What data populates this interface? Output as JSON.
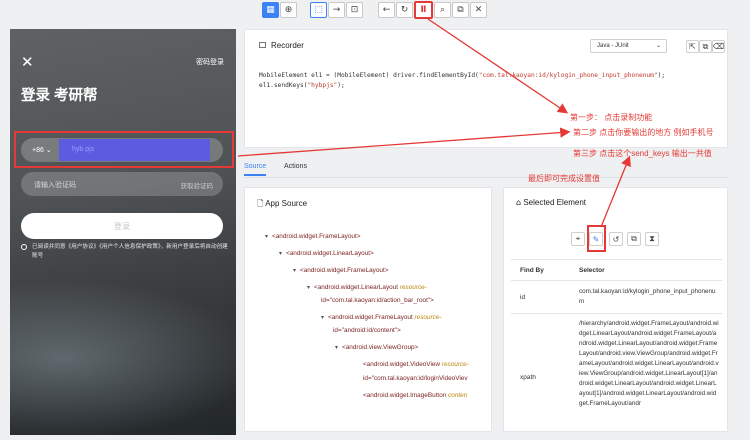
{
  "toolbar": {
    "buttons": [
      {
        "icon": "app-mode-icon",
        "glyph": "▦"
      },
      {
        "icon": "globe-icon",
        "glyph": "⊕"
      },
      {
        "icon": "select-element-icon",
        "glyph": "⬚"
      },
      {
        "icon": "swipe-icon",
        "glyph": "→"
      },
      {
        "icon": "tap-by-coordinates-icon",
        "glyph": "⊡"
      },
      {
        "icon": "back-icon",
        "glyph": "←"
      },
      {
        "icon": "refresh-icon",
        "glyph": "↻"
      },
      {
        "icon": "pause-record-icon",
        "glyph": "Ⅱ"
      },
      {
        "icon": "search-icon",
        "glyph": "⌕"
      },
      {
        "icon": "copy-xml-icon",
        "glyph": "⧉"
      },
      {
        "icon": "quit-icon",
        "glyph": "✕"
      }
    ]
  },
  "phone": {
    "close_glyph": "✕",
    "password_login": "密码登录",
    "title": "登录 考研帮",
    "country_code": "+86",
    "phone_value": "hyb pjs",
    "code_placeholder": "请输入验证码",
    "get_code": "获取验证码",
    "login_button": "登录",
    "agreement": "已阅读并同意《用户协议》《用户个人信息保护政策》，新用户登录后将自动创建账号"
  },
  "recorder": {
    "title": "Recorder",
    "language": "Java - JUnit",
    "code_line1_a": "MobileElement el1 = (MobileElement) driver.findElementById(",
    "code_line1_str": "\"com.tal.kaoyan:id/kylogin_phone_input_phonenum\"",
    "code_line1_b": ");",
    "code_line2_a": "el1.sendKeys(",
    "code_line2_str": "\"hybpjs\"",
    "code_line2_b": ");"
  },
  "tabs": {
    "source": "Source",
    "actions": "Actions"
  },
  "app_source": {
    "title": "App Source",
    "nodes": [
      {
        "text": "<android.widget.FrameLayout>",
        "attr": ""
      },
      {
        "text": "<android.widget.LinearLayout>",
        "attr": ""
      },
      {
        "text": "<android.widget.FrameLayout>",
        "attr": ""
      },
      {
        "text": "<android.widget.LinearLayout ",
        "attr": "resource-"
      },
      {
        "text": "id=\"com.tal.kaoyan:id/action_bar_root\">",
        "attr": ""
      },
      {
        "text": "<android.widget.FrameLayout ",
        "attr": "resource-"
      },
      {
        "text": "id=\"android:id/content\">",
        "attr": ""
      },
      {
        "text": "<android.view.ViewGroup>",
        "attr": ""
      },
      {
        "text": "<android.widget.VideoView ",
        "attr": "resource-"
      },
      {
        "text": "id=\"com.tal.kaoyan:id/loginVideoViev",
        "attr": ""
      },
      {
        "text": "<android.widget.ImageButton ",
        "attr": "conten"
      }
    ]
  },
  "selected": {
    "title": "Selected Element",
    "col_find_by": "Find By",
    "col_selector": "Selector",
    "row1_by": "id",
    "row1_sel": "com.tal.kaoyan:id/kylogin_phone_input_phonenum",
    "row2_by": "xpath",
    "row2_sel": "/hierarchy/android.widget.FrameLayout/android.widget.LinearLayout/android.widget.FrameLayout/android.widget.LinearLayout/android.widget.FrameLayout/android.view.ViewGroup/android.widget.FrameLayout/android.widget.LinearLayout/android.view.ViewGroup/android.widget.LinearLayout[1]/android.widget.LinearLayout/android.widget.LinearLayout[1]/android.widget.LinearLayout/android.widget.FrameLayout/andr"
  },
  "annotations": {
    "step1": "第一步： 点击录制功能",
    "step2": "第二步 点击你要输出的地方 例如手机号",
    "step3": "第三步 点击这个send_keys 输出一共值",
    "final": "最后即可完成设置值"
  },
  "colors": {
    "accent": "#3b82f6",
    "annotation": "#e53935",
    "phone_input": "#5b5ce0"
  }
}
